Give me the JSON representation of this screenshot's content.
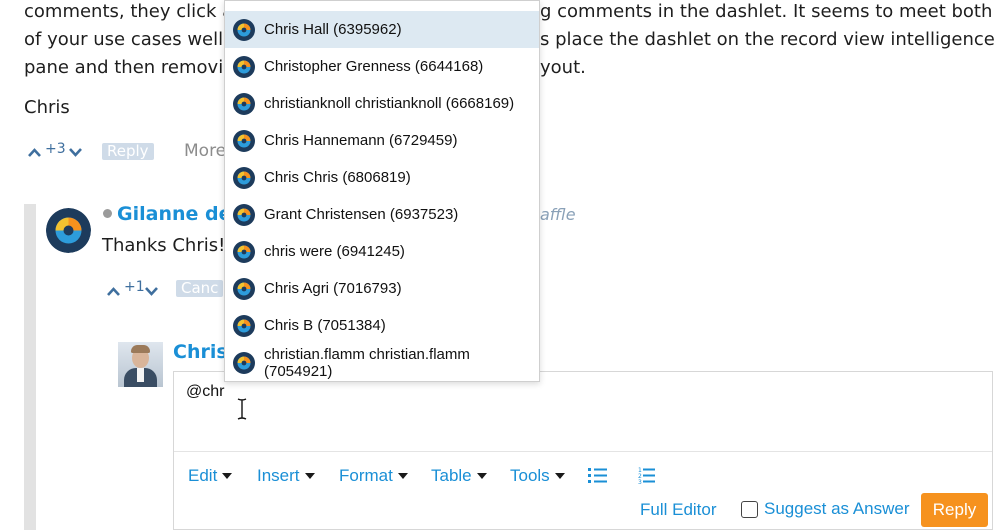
{
  "post": {
    "line1_left": "comments, they click a",
    "line1_right": "g comments in the dashlet. It seems to meet both",
    "line2_left": "of your use cases well",
    "line2_right": "s place the dashlet on the record view intelligence",
    "line3_left": "pane and then removi",
    "line3_right": "yout.",
    "signature": "Chris",
    "votes": "+3",
    "reply_label": "Reply",
    "more_label": "More"
  },
  "comment": {
    "author": "Gilanne del",
    "meta": "affle",
    "text": "Thanks Chris!",
    "votes": "+1",
    "action_label": "Canc"
  },
  "reply_author": "Chris",
  "mention_dropdown": {
    "items": [
      {
        "label": "Chris Hall (6395962)",
        "selected": true
      },
      {
        "label": "Christopher Grenness (6644168)"
      },
      {
        "label": "christianknoll christianknoll (6668169)"
      },
      {
        "label": "Chris Hannemann (6729459)"
      },
      {
        "label": "Chris Chris (6806819)"
      },
      {
        "label": "Grant Christensen (6937523)"
      },
      {
        "label": "chris were (6941245)"
      },
      {
        "label": "Chris Agri (7016793)"
      },
      {
        "label": "Chris B (7051384)"
      },
      {
        "label": "christian.flamm christian.flamm (7054921)"
      }
    ]
  },
  "editor": {
    "value": "@chr",
    "toolbar": {
      "edit": "Edit",
      "insert": "Insert",
      "format": "Format",
      "table": "Table",
      "tools": "Tools"
    },
    "full_editor": "Full Editor",
    "suggest_answer": "Suggest as Answer",
    "reply": "Reply"
  },
  "colors": {
    "link_blue": "#1a8fd6",
    "reply_orange": "#f6921e",
    "selected_row": "#dde9f2",
    "pill": "#cfdbe8"
  },
  "icons": [
    "chevron-up-icon",
    "chevron-down-icon",
    "logo-avatar-icon",
    "bullet-list-icon",
    "numbered-list-icon",
    "text-cursor-icon"
  ]
}
